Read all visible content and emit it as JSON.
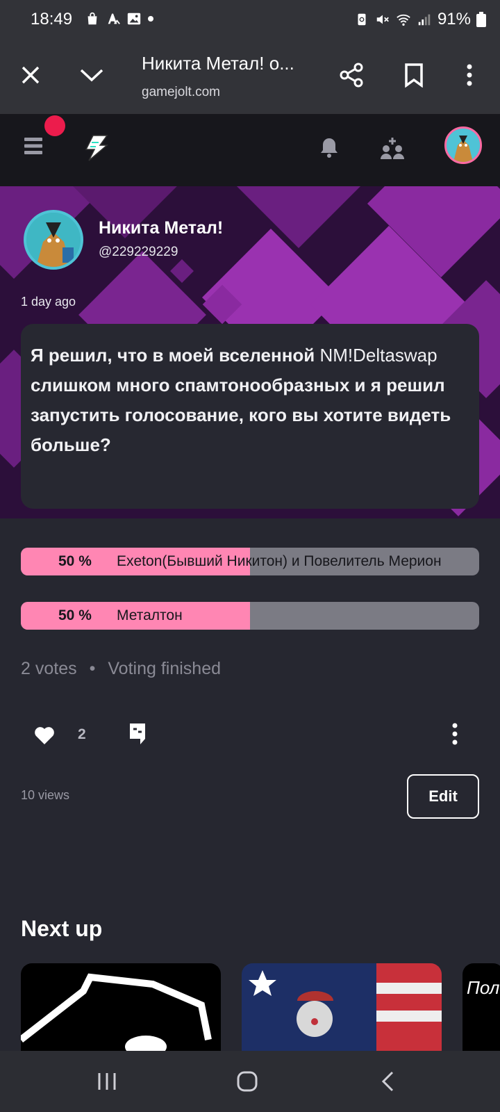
{
  "status_bar": {
    "time": "18:49",
    "battery": "91%",
    "left_icons": [
      "bag-icon",
      "translate-icon",
      "image-icon",
      "dot-icon"
    ],
    "right_icons": [
      "recycle-icon",
      "mute-icon",
      "wifi-icon",
      "signal-icon",
      "battery-icon"
    ]
  },
  "browser": {
    "title": "Никита Метал! о...",
    "url": "gamejolt.com"
  },
  "site_header": {
    "icons": [
      "menu-icon",
      "gamejolt-logo-icon",
      "bell-icon",
      "add-friend-icon",
      "user-avatar"
    ],
    "notification_color": "#ec1c4c"
  },
  "post": {
    "author_name": "Никита Метал!",
    "author_handle": "@229229229",
    "time": "1 day ago",
    "text_part1": "Я решил, что в моей вселенной ",
    "text_plain": "NM!Deltaswap",
    "text_part2": " слишком много спамтонообразных и я решил запустить голосование, кого вы хотите видеть больше?"
  },
  "poll": {
    "options": [
      {
        "percent": "50 %",
        "label": "Exeton(Бывший Никитон) и Повелитель Мерион",
        "fill": 0.5
      },
      {
        "percent": "50 %",
        "label": "Металтон",
        "fill": 0.5
      }
    ],
    "votes": "2 votes",
    "status": "Voting finished",
    "fill_color": "#ff86b3"
  },
  "actions": {
    "like_count": "2",
    "views": "10 views",
    "edit_label": "Edit"
  },
  "next_up": {
    "title": "Next up",
    "third_thumb_text": "Пол"
  }
}
